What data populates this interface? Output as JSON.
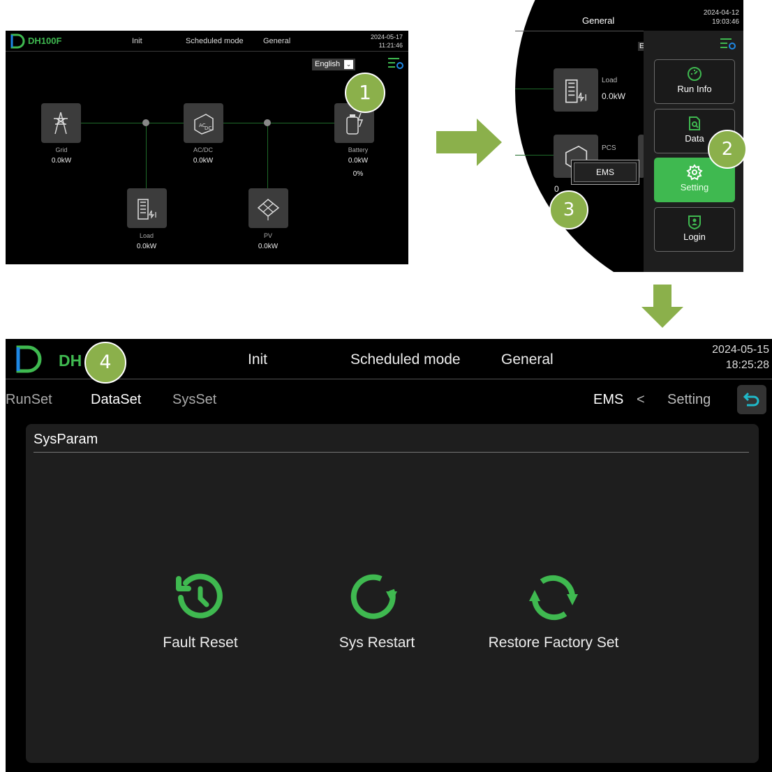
{
  "panel_a": {
    "brand": "DH100F",
    "status": "Init",
    "mode": "Scheduled mode",
    "level": "General",
    "date": "2024-05-17",
    "time": "11:21:46",
    "language": "English",
    "nodes": {
      "grid": {
        "label": "Grid",
        "power": "0.0kW"
      },
      "acdc": {
        "label": "AC/DC",
        "power": "0.0kW"
      },
      "battery": {
        "label": "Battery",
        "power": "0.0kW",
        "soc": "0%"
      },
      "load": {
        "label": "Load",
        "power": "0.0kW"
      },
      "pv": {
        "label": "PV",
        "power": "0.0kW"
      }
    }
  },
  "panel_b": {
    "level": "General",
    "date": "2024-04-12",
    "time": "19:03:46",
    "lang_partial": "E",
    "load": {
      "label": "Load",
      "power": "0.0kW"
    },
    "pcs": {
      "label": "PCS",
      "power_partial": "0"
    },
    "ems_popup": "EMS",
    "menu": {
      "run_info": "Run Info",
      "data": "Data",
      "setting": "Setting",
      "login": "Login"
    }
  },
  "panel_c": {
    "brand": "DH",
    "status": "Init",
    "mode": "Scheduled mode",
    "level": "General",
    "date": "2024-05-15",
    "time": "18:25:28",
    "tabs": [
      "RunSet",
      "DataSet",
      "SysSet"
    ],
    "breadcrumb": {
      "current": "EMS",
      "separator": "<",
      "parent": "Setting"
    },
    "card_title": "SysParam",
    "actions": {
      "fault_reset": "Fault Reset",
      "sys_restart": "Sys Restart",
      "restore_factory": "Restore Factory Set"
    }
  },
  "callouts": [
    "1",
    "2",
    "3",
    "4"
  ],
  "colors": {
    "accent": "#3fb950",
    "callout": "#8bb04b",
    "arrow": "#8bb04b",
    "panel_bg": "#000000",
    "card_bg": "#1e1e1e"
  }
}
